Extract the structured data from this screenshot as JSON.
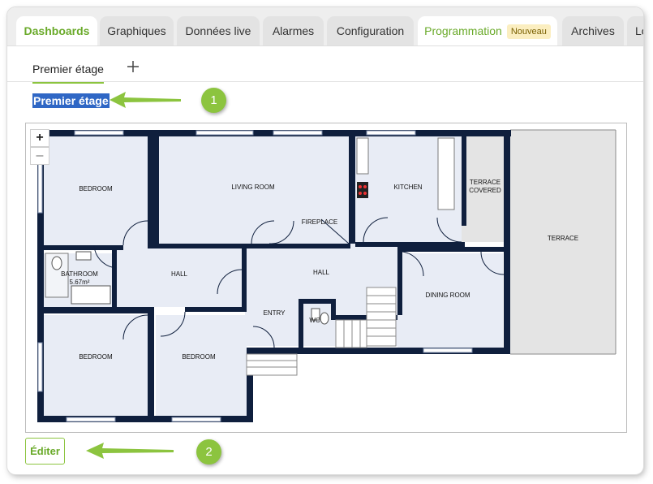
{
  "tabs": [
    {
      "label": "Dashboards"
    },
    {
      "label": "Graphiques"
    },
    {
      "label": "Données live"
    },
    {
      "label": "Alarmes"
    },
    {
      "label": "Configuration"
    },
    {
      "label": "Programmation",
      "badge": "Nouveau"
    },
    {
      "label": "Archives"
    },
    {
      "label": "Lo"
    }
  ],
  "subtab": {
    "label": "Premier étage",
    "add_icon": "plus-icon"
  },
  "floor_title": "Premier étage",
  "annotations": {
    "first": "1",
    "second": "2",
    "arrow_color": "#8cc43f"
  },
  "floorplan": {
    "zoom_in": "+",
    "zoom_out": "–",
    "rooms": {
      "bedroom_top": "BEDROOM",
      "living_room": "LIVING ROOM",
      "fireplace": "FIREPLACE",
      "kitchen": "KITCHEN",
      "terrace_covered_1": "TERRACE",
      "terrace_covered_2": "COVERED",
      "terrace": "TERRACE",
      "bathroom": "BATHROOM",
      "bathroom_area": "5.67m²",
      "hall_left": "HALL",
      "hall_center": "HALL",
      "dining_room": "DINING ROOM",
      "entry": "ENTRY",
      "wc": "WC",
      "bedroom_bottom_left": "BEDROOM",
      "bedroom_bottom_right": "BEDROOM"
    }
  },
  "edit_button": "Éditer",
  "colors": {
    "accent": "#8cc43f",
    "wall": "#0f1f3d",
    "room": "#e8ecf5",
    "terrace": "#e4e4e4",
    "selection": "#2f67c5"
  }
}
